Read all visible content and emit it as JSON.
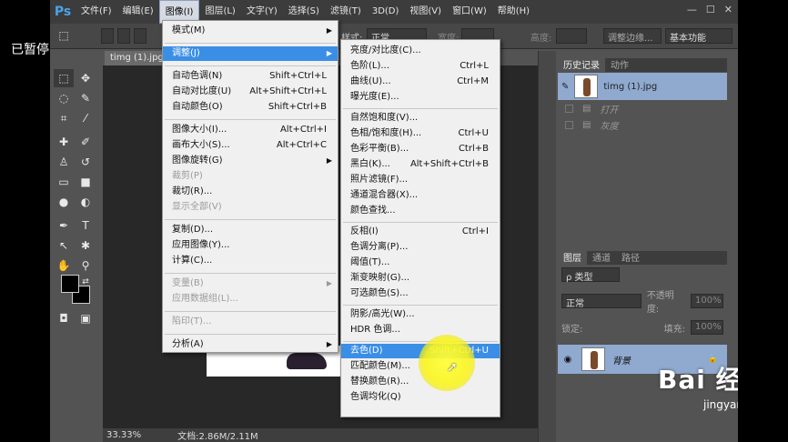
{
  "overlay": {
    "paused_text": "已暂停"
  },
  "menubar": {
    "logo": "Ps",
    "items": [
      "文件(F)",
      "编辑(E)",
      "图像(I)",
      "图层(L)",
      "文字(Y)",
      "选择(S)",
      "滤镜(T)",
      "3D(D)",
      "视图(V)",
      "窗口(W)",
      "帮助(H)"
    ],
    "active_index": 2,
    "window_controls": [
      "—",
      "☐",
      "✕"
    ]
  },
  "options_bar": {
    "style_label": "样式:",
    "style_value": "正常",
    "width_label": "宽度:",
    "height_label": "高度:",
    "refine_edge": "调整边缘...",
    "workspace": "基本功能"
  },
  "document": {
    "tab_title": "timg (1).jpg",
    "zoom": "33.33%",
    "doc_size": "文档:2.86M/2.11M"
  },
  "image_menu": {
    "items": [
      {
        "label": "模式(M)",
        "submenu": true
      },
      {
        "sep": true
      },
      {
        "label": "调整(J)",
        "submenu": true,
        "highlight": true
      },
      {
        "sep": true
      },
      {
        "label": "自动色调(N)",
        "shortcut": "Shift+Ctrl+L"
      },
      {
        "label": "自动对比度(U)",
        "shortcut": "Alt+Shift+Ctrl+L"
      },
      {
        "label": "自动颜色(O)",
        "shortcut": "Shift+Ctrl+B"
      },
      {
        "sep": true
      },
      {
        "label": "图像大小(I)...",
        "shortcut": "Alt+Ctrl+I"
      },
      {
        "label": "画布大小(S)...",
        "shortcut": "Alt+Ctrl+C"
      },
      {
        "label": "图像旋转(G)",
        "submenu": true
      },
      {
        "label": "裁剪(P)",
        "disabled": true
      },
      {
        "label": "裁切(R)..."
      },
      {
        "label": "显示全部(V)",
        "disabled": true
      },
      {
        "sep": true
      },
      {
        "label": "复制(D)..."
      },
      {
        "label": "应用图像(Y)..."
      },
      {
        "label": "计算(C)..."
      },
      {
        "sep": true
      },
      {
        "label": "变量(B)",
        "submenu": true,
        "disabled": true
      },
      {
        "label": "应用数据组(L)...",
        "disabled": true
      },
      {
        "sep": true
      },
      {
        "label": "陷印(T)...",
        "disabled": true
      },
      {
        "sep": true
      },
      {
        "label": "分析(A)",
        "submenu": true
      }
    ]
  },
  "adjust_menu": {
    "items": [
      {
        "label": "亮度/对比度(C)..."
      },
      {
        "label": "色阶(L)...",
        "shortcut": "Ctrl+L"
      },
      {
        "label": "曲线(U)...",
        "shortcut": "Ctrl+M"
      },
      {
        "label": "曝光度(E)..."
      },
      {
        "sep": true
      },
      {
        "label": "自然饱和度(V)..."
      },
      {
        "label": "色相/饱和度(H)...",
        "shortcut": "Ctrl+U"
      },
      {
        "label": "色彩平衡(B)...",
        "shortcut": "Ctrl+B"
      },
      {
        "label": "黑白(K)...",
        "shortcut": "Alt+Shift+Ctrl+B"
      },
      {
        "label": "照片滤镜(F)..."
      },
      {
        "label": "通道混合器(X)..."
      },
      {
        "label": "颜色查找..."
      },
      {
        "sep": true
      },
      {
        "label": "反相(I)",
        "shortcut": "Ctrl+I"
      },
      {
        "label": "色调分离(P)..."
      },
      {
        "label": "阈值(T)..."
      },
      {
        "label": "渐变映射(G)..."
      },
      {
        "label": "可选颜色(S)..."
      },
      {
        "sep": true
      },
      {
        "label": "阴影/高光(W)..."
      },
      {
        "label": "HDR 色调..."
      },
      {
        "sep": true
      },
      {
        "label": "去色(D)",
        "shortcut": "Shift+Ctrl+U",
        "highlight": true
      },
      {
        "label": "匹配颜色(M)..."
      },
      {
        "label": "替换颜色(R)..."
      },
      {
        "label": "色调均化(Q)"
      }
    ]
  },
  "history_panel": {
    "tabs": [
      "历史记录",
      "动作"
    ],
    "snapshot": "timg (1).jpg",
    "steps": [
      "打开",
      "灰度"
    ]
  },
  "layers_panel": {
    "tabs": [
      "图层",
      "通道",
      "路径"
    ],
    "filter_label": "ρ 类型",
    "blend_mode": "正常",
    "opacity_label": "不透明度:",
    "opacity_value": "100%",
    "lock_label": "锁定:",
    "fill_label": "填充:",
    "fill_value": "100%",
    "layer_name": "背景"
  },
  "watermark": {
    "logo": "Bai 经验",
    "sub": "jingyan.baidu.com"
  },
  "colors": {
    "accent": "#2f8de4",
    "panel_bg": "#535353",
    "menu_bg": "#f0f0f0"
  }
}
